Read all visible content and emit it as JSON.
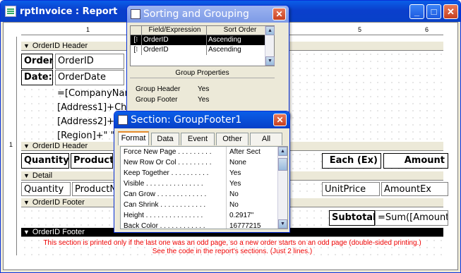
{
  "window": {
    "title": "rptInvoice : Report",
    "min": "_",
    "max": "□",
    "close": "✕"
  },
  "ruler": {
    "marks": [
      "1",
      "5",
      "6"
    ]
  },
  "vruler": {
    "mark": "1"
  },
  "bands": {
    "orderid_header": "OrderID Header",
    "orderid_header2": "OrderID Header",
    "detail": "Detail",
    "orderid_footer": "OrderID Footer",
    "orderid_footer2": "OrderID Footer"
  },
  "header_fields": {
    "order_label": "Order:",
    "order_value": "OrderID",
    "date_label": "Date:",
    "date_value": "OrderDate",
    "addr1": "=[CompanyNam",
    "addr2": "[Address1]+Chr(",
    "addr3": "[Address2]+C",
    "addr4": "[Region]+\" \""
  },
  "column_labels": {
    "quantity": "Quantity",
    "product": "Product",
    "each": "Each (Ex)",
    "amount": "Amount"
  },
  "detail_fields": {
    "quantity": "Quantity",
    "product": "ProductN",
    "unit_price": "UnitPrice",
    "amount_ex": "AmountEx"
  },
  "footer_fields": {
    "subtotal_label": "Subtotal:",
    "subtotal_value": "=Sum([AmountE"
  },
  "notes": {
    "line1": "This section is printed only if the last one was an odd page, so a new order starts on an odd page (double-sided printing.)",
    "line2": "See the code in the report's sections. (Just 2 lines.)"
  },
  "sorting_dialog": {
    "title": "Sorting and Grouping",
    "col_field": "Field/Expression",
    "col_sort": "Sort Order",
    "rows": [
      {
        "field": "OrderID",
        "sort": "Ascending"
      },
      {
        "field": "OrderID",
        "sort": "Ascending"
      }
    ],
    "group_props_title": "Group Properties",
    "group_header_label": "Group Header",
    "group_header_value": "Yes",
    "group_footer_label": "Group Footer",
    "group_footer_value": "Yes"
  },
  "section_dialog": {
    "title": "Section: GroupFooter1",
    "tabs": [
      "Format",
      "Data",
      "Event",
      "Other",
      "All"
    ],
    "props": [
      {
        "k": "Force New Page . . . . . . . . .",
        "v": "After Sect"
      },
      {
        "k": "New Row Or Col . . . . . . . . .",
        "v": "None"
      },
      {
        "k": "Keep Together . . . . . . . . . .",
        "v": "Yes"
      },
      {
        "k": "Visible . . . . . . . . . . . . . . .",
        "v": "Yes"
      },
      {
        "k": "Can Grow . . . . . . . . . . . . .",
        "v": "No"
      },
      {
        "k": "Can Shrink . . . . . . . . . . . .",
        "v": "No"
      },
      {
        "k": "Height . . . . . . . . . . . . . . .",
        "v": "0.2917\""
      },
      {
        "k": "Back Color . . . . . . . . . . . .",
        "v": "16777215"
      }
    ]
  }
}
